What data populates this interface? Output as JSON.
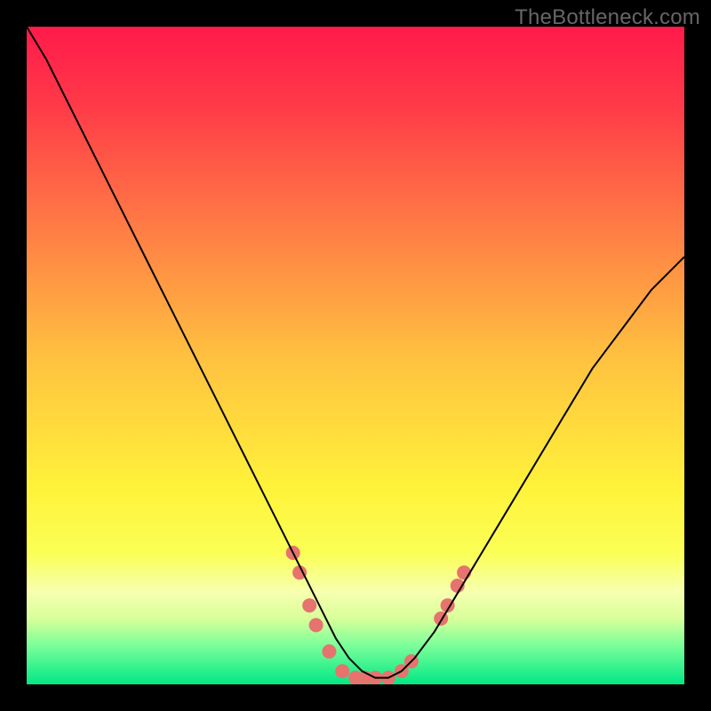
{
  "watermark": "TheBottleneck.com",
  "chart_data": {
    "type": "line",
    "title": "",
    "xlabel": "",
    "ylabel": "",
    "xlim": [
      0,
      100
    ],
    "ylim": [
      0,
      100
    ],
    "background_gradient_stops": [
      {
        "pct": 0,
        "color": "#ff1a4b"
      },
      {
        "pct": 12,
        "color": "#ff3a48"
      },
      {
        "pct": 30,
        "color": "#ff7a45"
      },
      {
        "pct": 50,
        "color": "#ffc040"
      },
      {
        "pct": 70,
        "color": "#fff23a"
      },
      {
        "pct": 80,
        "color": "#fbff55"
      },
      {
        "pct": 86,
        "color": "#f6ffb0"
      },
      {
        "pct": 90,
        "color": "#d8ff9a"
      },
      {
        "pct": 94,
        "color": "#7dff9a"
      },
      {
        "pct": 100,
        "color": "#00e884"
      }
    ],
    "series": [
      {
        "name": "bottleneck-curve",
        "color": "#000000",
        "stroke_width": 2,
        "x": [
          0,
          3,
          6,
          9,
          12,
          15,
          18,
          21,
          24,
          27,
          30,
          33,
          36,
          39,
          42,
          45,
          47,
          49,
          51,
          53,
          55,
          57,
          59,
          62,
          65,
          68,
          71,
          74,
          77,
          80,
          83,
          86,
          89,
          92,
          95,
          98,
          100
        ],
        "y": [
          100,
          95,
          89,
          83,
          77,
          71,
          65,
          59,
          53,
          47,
          41,
          35,
          29,
          23,
          17,
          11,
          7,
          4,
          2,
          1,
          1,
          2,
          4,
          8,
          13,
          18,
          23,
          28,
          33,
          38,
          43,
          48,
          52,
          56,
          60,
          63,
          65
        ]
      }
    ],
    "markers": {
      "name": "highlight-dots",
      "color": "#e6736e",
      "radius": 8,
      "points": [
        {
          "x": 40.5,
          "y": 20
        },
        {
          "x": 41.5,
          "y": 17
        },
        {
          "x": 43.0,
          "y": 12
        },
        {
          "x": 44.0,
          "y": 9
        },
        {
          "x": 46.0,
          "y": 5
        },
        {
          "x": 48.0,
          "y": 2
        },
        {
          "x": 50.0,
          "y": 1
        },
        {
          "x": 51.5,
          "y": 1
        },
        {
          "x": 53.0,
          "y": 1
        },
        {
          "x": 55.0,
          "y": 1
        },
        {
          "x": 57.0,
          "y": 2
        },
        {
          "x": 58.5,
          "y": 3.5
        },
        {
          "x": 63.0,
          "y": 10
        },
        {
          "x": 64.0,
          "y": 12
        },
        {
          "x": 65.5,
          "y": 15
        },
        {
          "x": 66.5,
          "y": 17
        }
      ]
    }
  }
}
